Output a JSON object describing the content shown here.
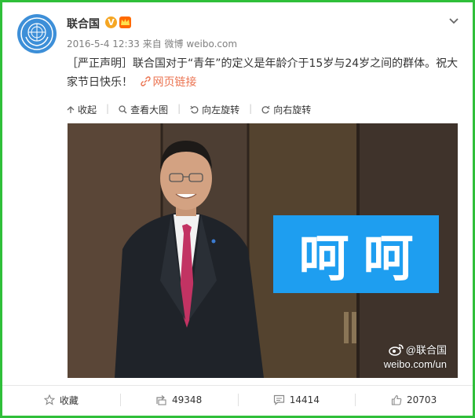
{
  "post": {
    "username": "联合国",
    "verified_badge": "V",
    "timestamp": "2016-5-4 12:33",
    "source": "来自 微博 weibo.com",
    "text": "［严正声明］联合国对于“青年”的定义是年龄介于15岁与24岁之间的群体。祝大家节日快乐！",
    "link_label": "网页链接"
  },
  "toolbar": {
    "collapse": "收起",
    "view_large": "查看大图",
    "rotate_left": "向左旋转",
    "rotate_right": "向右旋转"
  },
  "image": {
    "overlay_text": "呵呵",
    "watermark_name": "@联合国",
    "watermark_url": "weibo.com/un"
  },
  "actions": {
    "favorite": "收藏",
    "repost_count": "49348",
    "comment_count": "14414",
    "like_count": "20703"
  },
  "colors": {
    "frame": "#2fbf3a",
    "accent": "#eb7350",
    "overlay_blue": "#1e9ef0",
    "avatar_blue": "#3d8fd8"
  }
}
